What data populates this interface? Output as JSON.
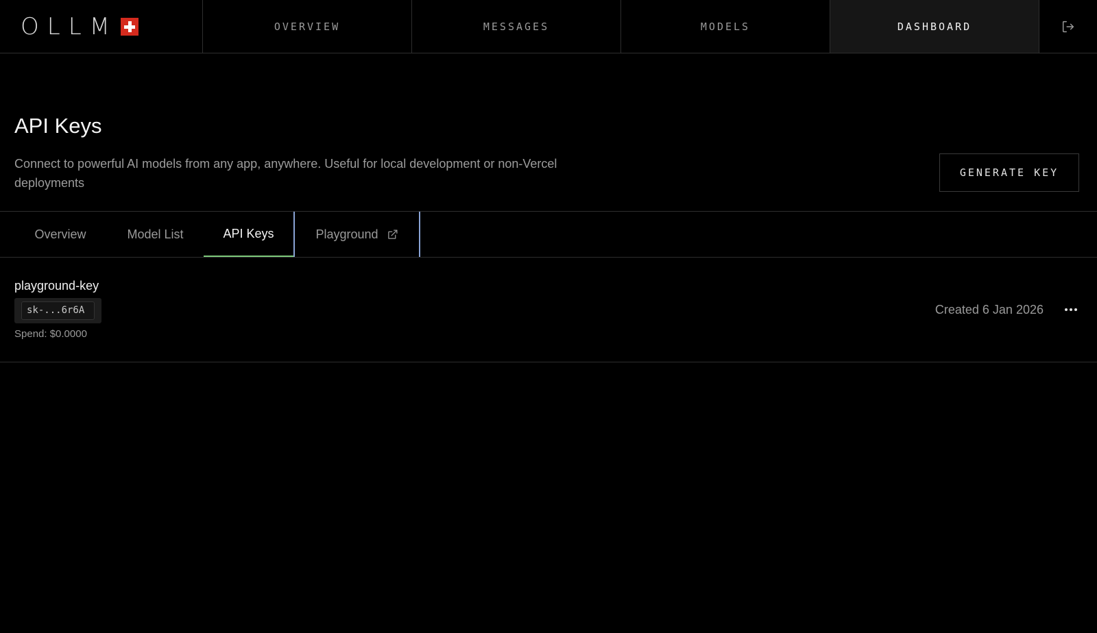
{
  "brand": {
    "logo_text": "OLLM"
  },
  "nav": {
    "items": [
      {
        "label": "OVERVIEW"
      },
      {
        "label": "MESSAGES"
      },
      {
        "label": "MODELS"
      },
      {
        "label": "DASHBOARD",
        "active": true
      }
    ]
  },
  "header": {
    "title": "API Keys",
    "description": "Connect to powerful AI models from any app, anywhere. Useful for local development or non-Vercel deployments",
    "generate_label": "GENERATE KEY"
  },
  "tabs": [
    {
      "label": "Overview"
    },
    {
      "label": "Model List"
    },
    {
      "label": "API Keys",
      "active": true
    },
    {
      "label": "Playground",
      "icon": "external-link-icon"
    }
  ],
  "keys": [
    {
      "name": "playground-key",
      "masked": "sk-...6r6A",
      "spend": "Spend: $0.0000",
      "created": "Created 6 Jan 2026"
    }
  ],
  "colors": {
    "background": "#000000",
    "active_tab_underline": "#7ec97a",
    "focus_outline": "#8aa4d6",
    "flag_red": "#d52b1e"
  },
  "icons": [
    "logout-icon",
    "external-link-icon",
    "more-horizontal-icon",
    "swiss-flag-icon"
  ]
}
